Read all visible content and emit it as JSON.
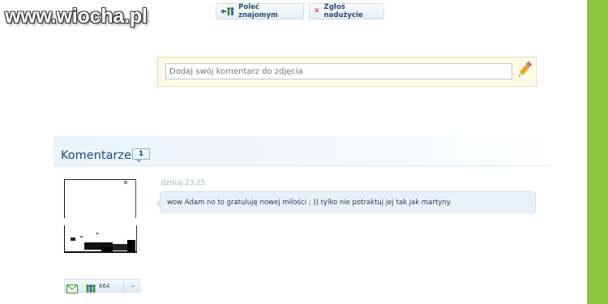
{
  "watermark": {
    "text": "www.wiocha.pl"
  },
  "toolbar": {
    "recommend_label": "Poleć znajomym",
    "report_label": "Zgłoś nadużycie"
  },
  "comment_form": {
    "placeholder": "Dodaj swój komentarz do zdjęcia"
  },
  "comments": {
    "title": "Komentarze",
    "count": "1",
    "items": [
      {
        "time": "dzisiaj 23:25",
        "text": "wow Adam no to gratuluję nowej miłości ; )) tylko nie potraktuj jej tak jak martyny.",
        "user": {
          "friends_count": "664"
        }
      }
    ]
  },
  "colors": {
    "accent_green": "#8cc63f",
    "link_blue": "#1f4a7a",
    "bubble_bg": "#e8f1f8",
    "form_bg": "#fffbe8"
  },
  "icons": [
    "people-arrow-icon",
    "close-icon",
    "pencil-icon",
    "envelope-icon",
    "people-icon",
    "chevron-down-icon"
  ]
}
